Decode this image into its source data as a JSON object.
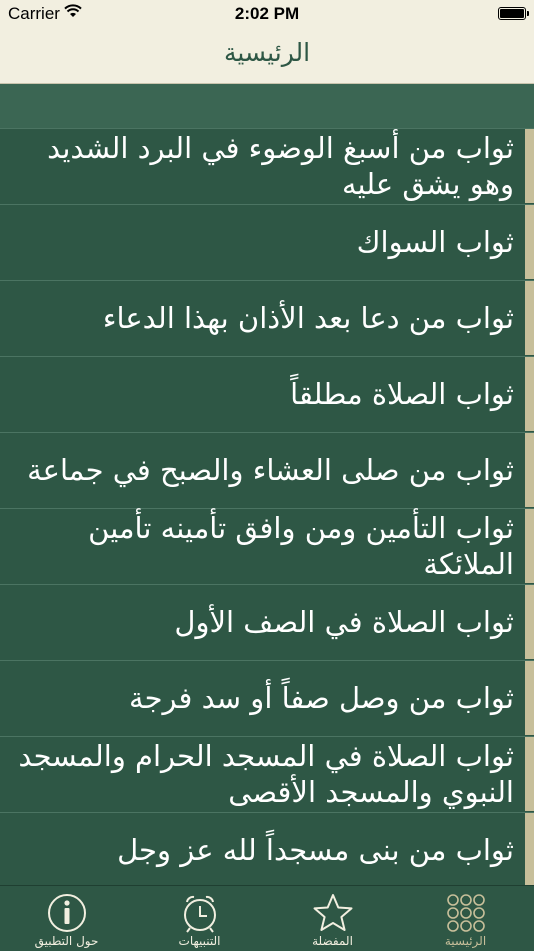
{
  "status": {
    "carrier": "Carrier",
    "time": "2:02 PM"
  },
  "nav": {
    "title": "الرئيسية"
  },
  "items": [
    {
      "text": "ثواب من أسبغ الوضوء في البرد الشديد وهو يشق عليه"
    },
    {
      "text": "ثواب السواك"
    },
    {
      "text": "ثواب من دعا بعد الأذان بهذا الدعاء"
    },
    {
      "text": "ثواب الصلاة مطلقاً"
    },
    {
      "text": "ثواب من صلى العشاء والصبح في جماعة"
    },
    {
      "text": "ثواب التأمين ومن وافق تأمينه تأمين الملائكة"
    },
    {
      "text": "ثواب الصلاة في الصف الأول"
    },
    {
      "text": "ثواب من وصل صفاً أو سد فرجة"
    },
    {
      "text": "ثواب الصلاة في المسجد الحرام والمسجد النبوي والمسجد الأقصى"
    },
    {
      "text": "ثواب من بنى مسجداً لله عز وجل"
    }
  ],
  "tabs": [
    {
      "label": "حول التطبيق",
      "icon": "info-icon"
    },
    {
      "label": "التنبيهات",
      "icon": "alarm-clock-icon"
    },
    {
      "label": "المفضلة",
      "icon": "star-icon"
    },
    {
      "label": "الرئيسية",
      "icon": "grid-icon",
      "active": true
    }
  ],
  "colors": {
    "background": "#2e5745",
    "accent": "#c7bf9a",
    "navbar": "#f2efe0"
  }
}
